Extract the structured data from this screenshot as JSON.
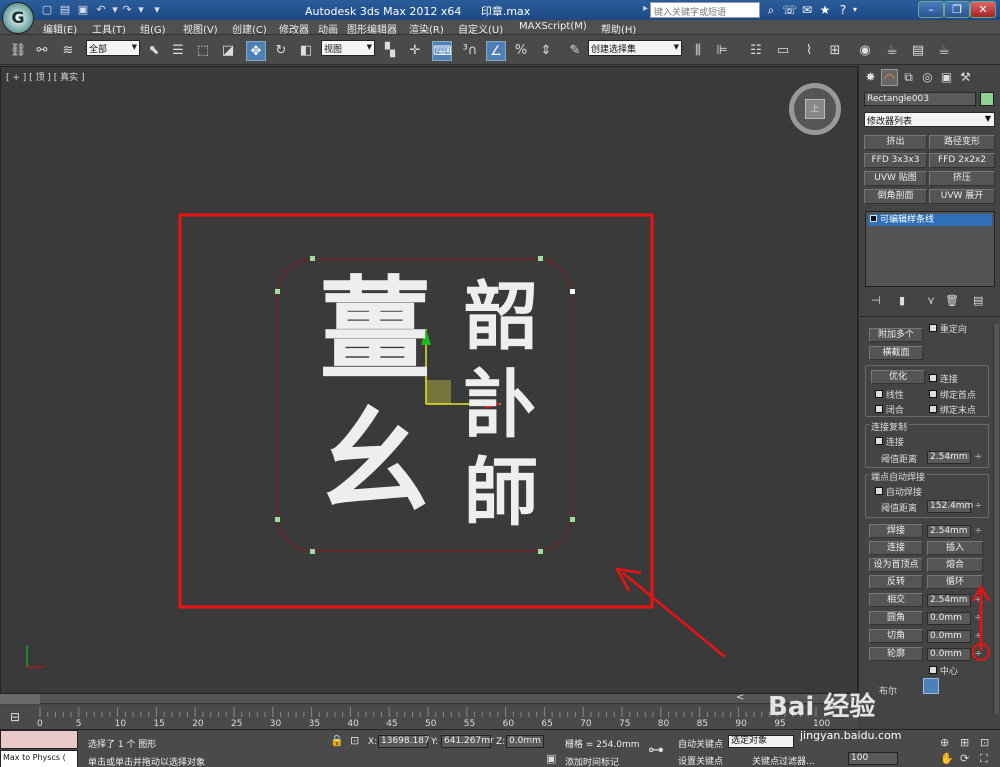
{
  "app": {
    "title": "Autodesk 3ds Max  2012 x64",
    "document": "印章.max",
    "search_placeholder": "键入关键字或短语"
  },
  "menu": [
    "编辑(E)",
    "工具(T)",
    "组(G)",
    "视图(V)",
    "创建(C)",
    "修改器",
    "动画",
    "图形编辑器",
    "渲染(R)",
    "自定义(U)",
    "MAXScript(M)",
    "帮助(H)"
  ],
  "toolbar": {
    "selection_filter": "全部",
    "ref_coord": "视图",
    "named_selection": "创建选择集"
  },
  "viewport": {
    "label": "[ + ] [ 顶 ] [ 真实 ]",
    "viewcube_face": "上",
    "seal_left_chars": [
      "薑",
      "幺"
    ],
    "seal_right_chars": [
      "韶",
      "訃",
      "師"
    ]
  },
  "command_panel": {
    "object_name": "Rectangle003",
    "object_color": "#8fd18f",
    "modifier_list": "修改器列表",
    "modifier_buttons": [
      "挤出",
      "路径变形",
      "FFD 3x3x3",
      "FFD 2x2x2",
      "UVW 贴图",
      "挤压",
      "倒角剖面",
      "UVW 展开"
    ],
    "stack_item": "可编辑样条线",
    "stack_icons": [
      "pin-icon",
      "show-end-result-icon",
      "make-unique-icon",
      "remove-modifier-icon",
      "configure-sets-icon"
    ],
    "geometry": {
      "attach_multiple": "附加多个",
      "reorient": "重定向",
      "cross_section": "横截面",
      "refine": "优化",
      "connect": "连接",
      "linear": "线性",
      "bind_first": "绑定首点",
      "closed": "闭合",
      "bind_last": "绑定末点",
      "connect_copy_group": "连接复制",
      "connect_copy": "连接",
      "threshold_label": "阈值距离",
      "threshold_value": "2.54mm",
      "auto_weld_group": "端点自动焊接",
      "auto_weld": "自动焊接",
      "auto_weld_threshold": "152.4mm",
      "weld": "焊接",
      "weld_value": "2.54mm",
      "connect2": "连接",
      "insert": "插入",
      "make_first": "设为首顶点",
      "fuse": "熔合",
      "reverse": "反转",
      "cycle": "循环",
      "crossinsert": "相交",
      "crossinsert_value": "2.54mm",
      "fillet": "圆角",
      "fillet_value": "0.0mm",
      "chamfer": "切角",
      "chamfer_value": "0.0mm",
      "outline": "轮廓",
      "outline_value": "0.0mm",
      "center": "中心",
      "boolean": "布尔"
    }
  },
  "timeline": {
    "ticks": [
      "0",
      "5",
      "10",
      "15",
      "20",
      "25",
      "30",
      "35",
      "40",
      "45",
      "50",
      "55",
      "60",
      "65",
      "70",
      "75",
      "80",
      "85",
      "90",
      "95",
      "100"
    ]
  },
  "status": {
    "maxscript": "Max to Physcs (",
    "selection": "选择了 1 个 图形",
    "prompt": "单击或单击并拖动以选择对象",
    "x_label": "X:",
    "x_value": "13698.187",
    "y_label": "Y:",
    "y_value": "641.267mr",
    "z_label": "Z:",
    "z_value": "0.0mm",
    "grid": "栅格 = 254.0mm",
    "add_time_tag": "添加时间标记",
    "auto_key": "自动关键点",
    "selected": "选定对象",
    "set_key": "设置关键点",
    "key_filters": "关键点过滤器...",
    "frame": "100"
  },
  "watermark": {
    "brand": "Bai 经验",
    "url": "jingyan.baidu.com"
  }
}
